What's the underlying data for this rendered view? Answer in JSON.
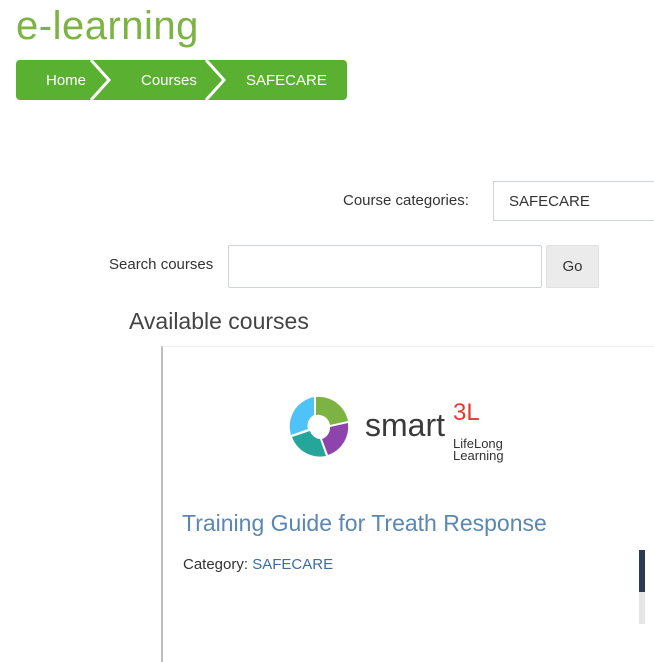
{
  "header": {
    "site_title": "e-learning"
  },
  "breadcrumb": {
    "items": [
      {
        "label": "Home"
      },
      {
        "label": "Courses"
      },
      {
        "label": "SAFECARE"
      }
    ],
    "color": "#5ab030"
  },
  "filters": {
    "category_label": "Course categories:",
    "category_selected": "SAFECARE",
    "search_label": "Search courses",
    "search_value": "",
    "go_label": "Go"
  },
  "main": {
    "heading": "Available courses",
    "courses": [
      {
        "logo_text": "smart",
        "logo_superscript": "3L",
        "logo_line1": "LifeLong",
        "logo_line2": "Learning",
        "title": "Training Guide for Treath Response",
        "category_prefix": "Category:",
        "category_name": "SAFECARE"
      }
    ]
  },
  "colors": {
    "accent_green": "#7cb342",
    "link_blue": "#5a87b4",
    "logo_red": "#e53935"
  }
}
